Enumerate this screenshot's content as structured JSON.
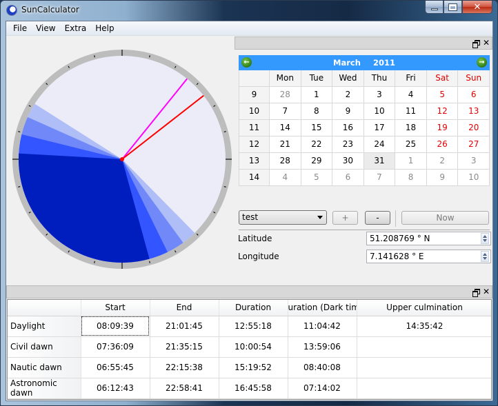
{
  "window": {
    "title": "SunCalculator",
    "controls": {
      "minimize": "minimize",
      "maximize": "maximize",
      "close": "close"
    }
  },
  "menu": [
    "File",
    "View",
    "Extra",
    "Help"
  ],
  "dial": {
    "type": "24-hour sun clock (noon at top, midnight at bottom)",
    "hour_ticks": 24,
    "colors": {
      "day": "#ebecf7",
      "civil": "#b0bef8",
      "nautic": "#7189f8",
      "astronomic": "#3355ff",
      "night": "#001ebe",
      "ring": "#bdbdbd",
      "current_time_hand": "#ff0000",
      "culmination_hand": "#ff00ff"
    },
    "periods": {
      "daylight": [
        "08:09:39",
        "21:01:45"
      ],
      "civil": [
        "07:36:09",
        "21:35:15"
      ],
      "nautic": [
        "06:55:45",
        "22:15:38"
      ],
      "astronomic": [
        "06:12:43",
        "22:58:41"
      ]
    },
    "culmination_time": "14:35:42",
    "current_time_approx": "15:28"
  },
  "calendar": {
    "month": "March",
    "year": "2011",
    "weekdays": [
      "Mon",
      "Tue",
      "Wed",
      "Thu",
      "Fri",
      "Sat",
      "Sun"
    ],
    "weeks": [
      {
        "week": "9",
        "days": [
          "28",
          "1",
          "2",
          "3",
          "4",
          "5",
          "6"
        ]
      },
      {
        "week": "10",
        "days": [
          "7",
          "8",
          "9",
          "10",
          "11",
          "12",
          "13"
        ]
      },
      {
        "week": "11",
        "days": [
          "14",
          "15",
          "16",
          "17",
          "18",
          "19",
          "20"
        ]
      },
      {
        "week": "12",
        "days": [
          "21",
          "22",
          "23",
          "24",
          "25",
          "26",
          "27"
        ]
      },
      {
        "week": "13",
        "days": [
          "28",
          "29",
          "30",
          "31",
          "1",
          "2",
          "3"
        ]
      },
      {
        "week": "14",
        "days": [
          "4",
          "5",
          "6",
          "7",
          "8",
          "9",
          "10"
        ]
      }
    ],
    "selected_day": "31",
    "colors": {
      "header": "#3399ff",
      "weekend": "#e00000",
      "other_month": "#8a8a8a"
    }
  },
  "location": {
    "preset": "test",
    "add_label": "+",
    "remove_label": "-",
    "now_label": "Now",
    "latitude_label": "Latitude",
    "latitude_value": "51.208769 ° N",
    "longitude_label": "Longitude",
    "longitude_value": "7.141628 ° E"
  },
  "table": {
    "columns": [
      "",
      "Start",
      "End",
      "Duration",
      "uration (Dark time",
      "Upper culmination"
    ],
    "rows": [
      {
        "label": "Daylight",
        "start": "08:09:39",
        "end": "21:01:45",
        "duration": "12:55:18",
        "dark": "11:04:42",
        "culmination": "14:35:42"
      },
      {
        "label": "Civil dawn",
        "start": "07:36:09",
        "end": "21:35:15",
        "duration": "10:00:54",
        "dark": "13:59:06",
        "culmination": ""
      },
      {
        "label": "Nautic dawn",
        "start": "06:55:45",
        "end": "22:15:38",
        "duration": "15:19:52",
        "dark": "08:40:08",
        "culmination": ""
      },
      {
        "label": "Astronomic dawn",
        "start": "06:12:43",
        "end": "22:58:41",
        "duration": "16:45:58",
        "dark": "07:14:02",
        "culmination": ""
      }
    ]
  }
}
